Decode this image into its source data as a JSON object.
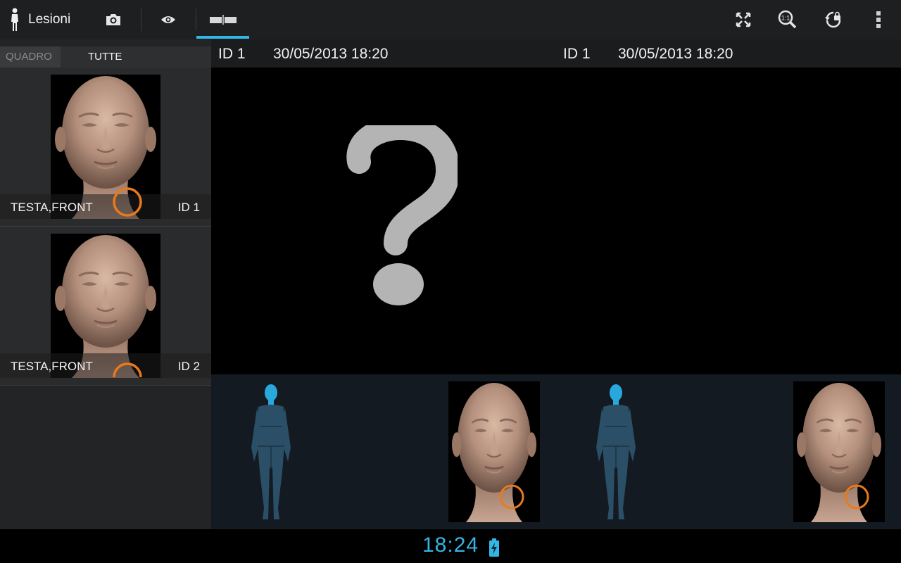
{
  "app": {
    "title": "Lesioni"
  },
  "actionbar": {
    "icons": [
      "person-icon",
      "camera-icon",
      "eye-icon",
      "compare-icon",
      "fullscreen-icon",
      "zoom-1to1-icon",
      "rotate-lock-icon",
      "overflow-menu-icon"
    ],
    "active_tab": "compare",
    "accent_color": "#33b5e5"
  },
  "sidebar": {
    "tabs": [
      {
        "label": "QUADRO"
      },
      {
        "label": "TUTTE"
      }
    ],
    "items": [
      {
        "label": "TESTA,FRONT",
        "id": "ID 1"
      },
      {
        "label": "TESTA,FRONT",
        "id": "ID 2"
      }
    ]
  },
  "compare": {
    "left": {
      "id": "ID 1",
      "datetime": "30/05/2013 18:20"
    },
    "right": {
      "id": "ID 1",
      "datetime": "30/05/2013 18:20"
    },
    "placeholder_icon": "question-mark-icon"
  },
  "marker_color": "#e87a1c",
  "status": {
    "time": "18:24",
    "battery_icon": "battery-charging-icon"
  }
}
